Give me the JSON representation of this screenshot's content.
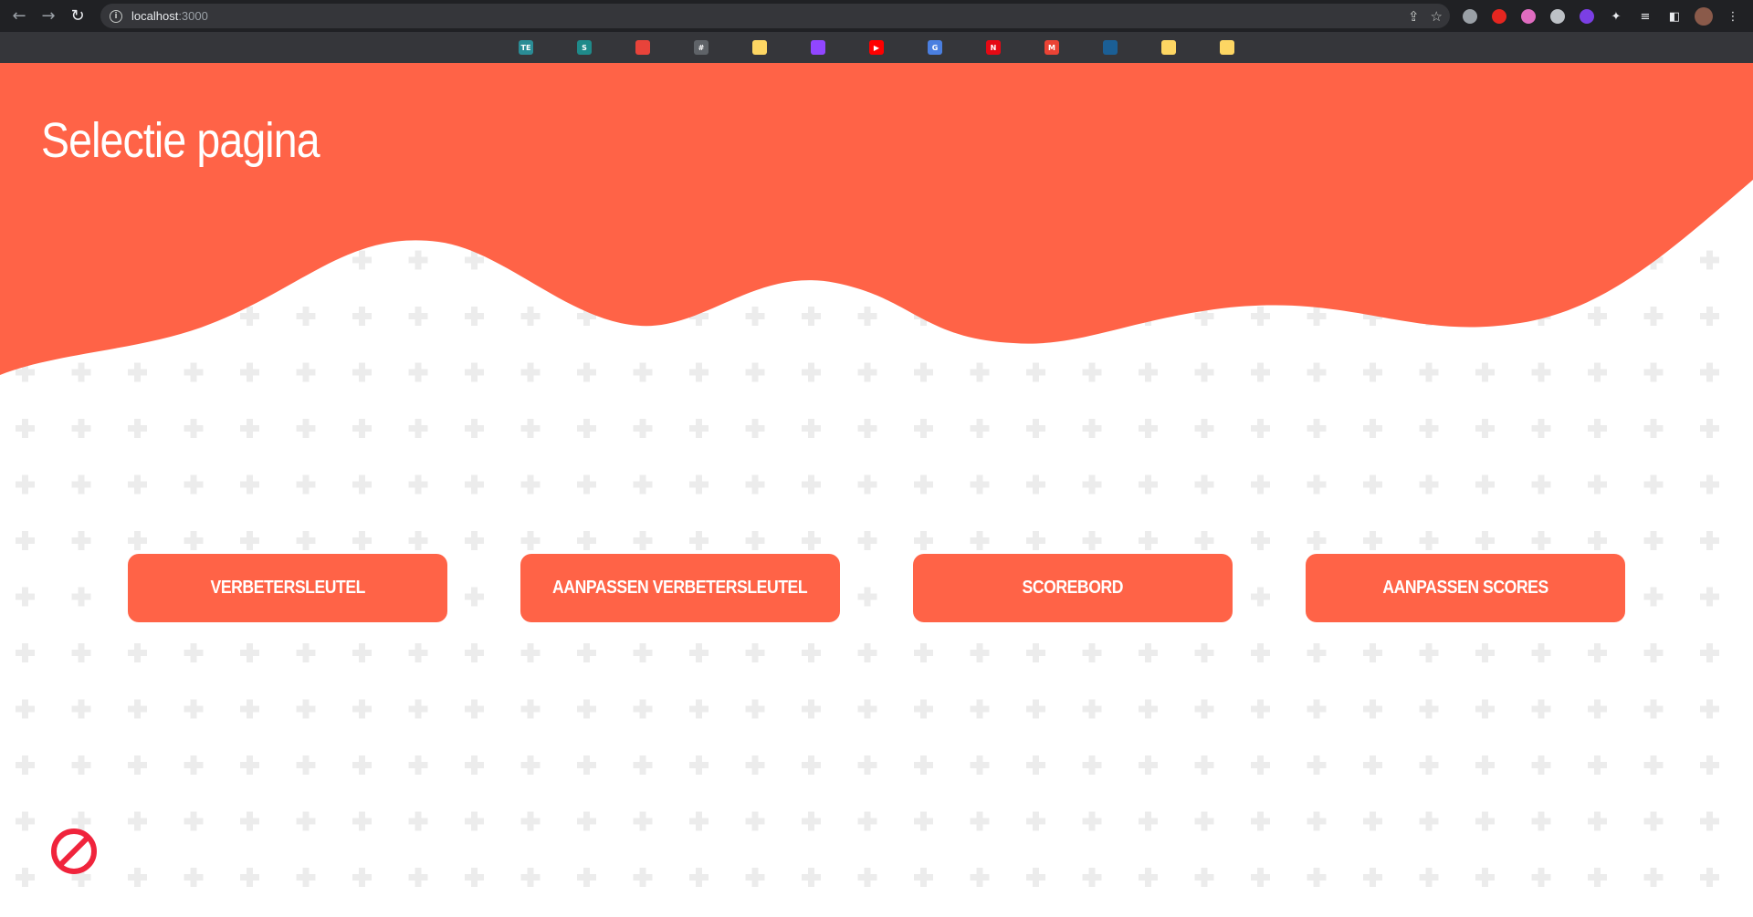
{
  "browser": {
    "back_glyph": "←",
    "forward_glyph": "→",
    "reload_glyph": "↻",
    "url_host": "localhost",
    "url_port": ":3000",
    "share_glyph": "⇪",
    "star_glyph": "☆",
    "bookmarks": [
      {
        "name": "teams-bookmark",
        "text": "TE",
        "color": "#2a8c95"
      },
      {
        "name": "sharepoint-bookmark",
        "text": "S",
        "color": "#1f8a8a"
      },
      {
        "name": "dashed-circle-bookmark",
        "text": "",
        "color": "#e8433a"
      },
      {
        "name": "hash-bookmark",
        "text": "#",
        "color": "#5f6368"
      },
      {
        "name": "note-bookmark",
        "text": "",
        "color": "#fdd663"
      },
      {
        "name": "twitch-bookmark",
        "text": "",
        "color": "#9146ff"
      },
      {
        "name": "youtube-bookmark",
        "text": "▶",
        "color": "#ff0000"
      },
      {
        "name": "translate-bookmark",
        "text": "G",
        "color": "#4a7fe0"
      },
      {
        "name": "netflix-bookmark",
        "text": "N",
        "color": "#e50914"
      },
      {
        "name": "gmail-bookmark",
        "text": "M",
        "color": "#ea4335"
      },
      {
        "name": "steam-bookmark",
        "text": "",
        "color": "#1b5f95"
      },
      {
        "name": "note-bookmark-2",
        "text": "",
        "color": "#fdd663"
      },
      {
        "name": "note-bookmark-3",
        "text": "",
        "color": "#fdd663"
      }
    ],
    "extensions": [
      {
        "name": "extension-gray-icon",
        "color": "#9aa0a6"
      },
      {
        "name": "extension-red-icon",
        "color": "#e52620"
      },
      {
        "name": "extension-gradient-icon",
        "color": "#e06cc0"
      },
      {
        "name": "extension-camera-icon",
        "color": "#bdc1c6"
      },
      {
        "name": "extension-p-icon",
        "color": "#7b3fe4"
      }
    ],
    "puzzle_glyph": "✦",
    "media_glyph": "≡",
    "sidepanel_glyph": "◧",
    "menu_glyph": "⋮"
  },
  "page": {
    "title": "Selectie pagina",
    "accent": "#ff6347",
    "buttons": [
      {
        "label": "VERBETERSLEUTEL"
      },
      {
        "label": "AANPASSEN VERBETERSLEUTEL"
      },
      {
        "label": "SCOREBORD"
      },
      {
        "label": "AANPASSEN SCORES"
      }
    ],
    "block_icon_color": "#f0243c"
  }
}
